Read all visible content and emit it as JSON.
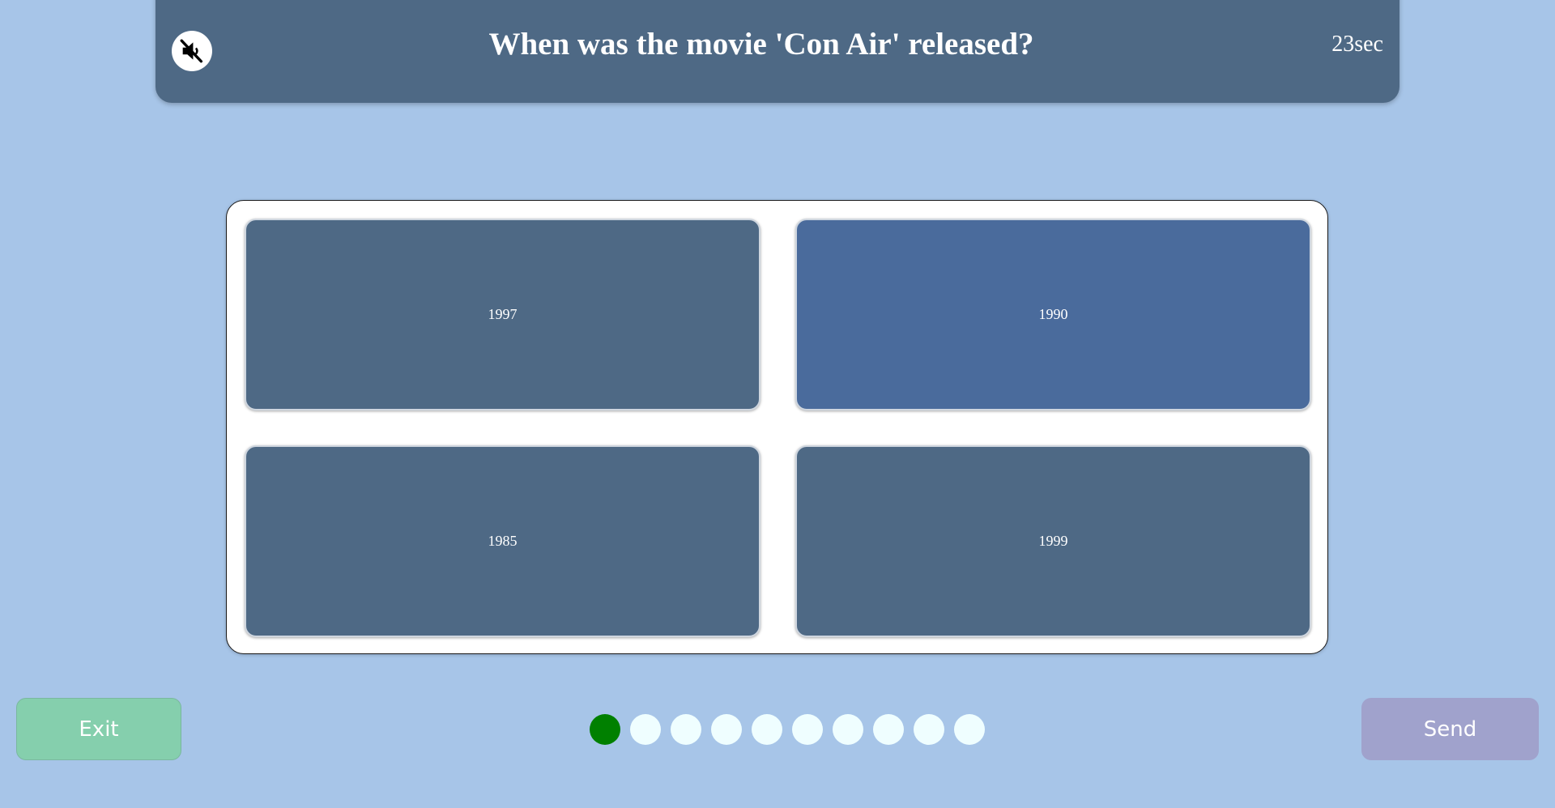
{
  "header": {
    "question": "When was the movie 'Con Air' released?",
    "timer": "23sec",
    "mute_icon": "speaker-muted-icon"
  },
  "answers": [
    {
      "label": "1997"
    },
    {
      "label": "1990"
    },
    {
      "label": "1985"
    },
    {
      "label": "1999"
    }
  ],
  "footer": {
    "exit_label": "Exit",
    "send_label": "Send"
  },
  "progress": {
    "total": 10,
    "completed": 1,
    "completed_color": "#008000",
    "pending_color": "#effeff"
  },
  "colors": {
    "background": "#a7c5e8",
    "header": "#4e6985",
    "answer": "#4e6985",
    "answer_highlight": "#4a6b9c",
    "exit": "#85cfad",
    "send": "#a0a2cc"
  }
}
